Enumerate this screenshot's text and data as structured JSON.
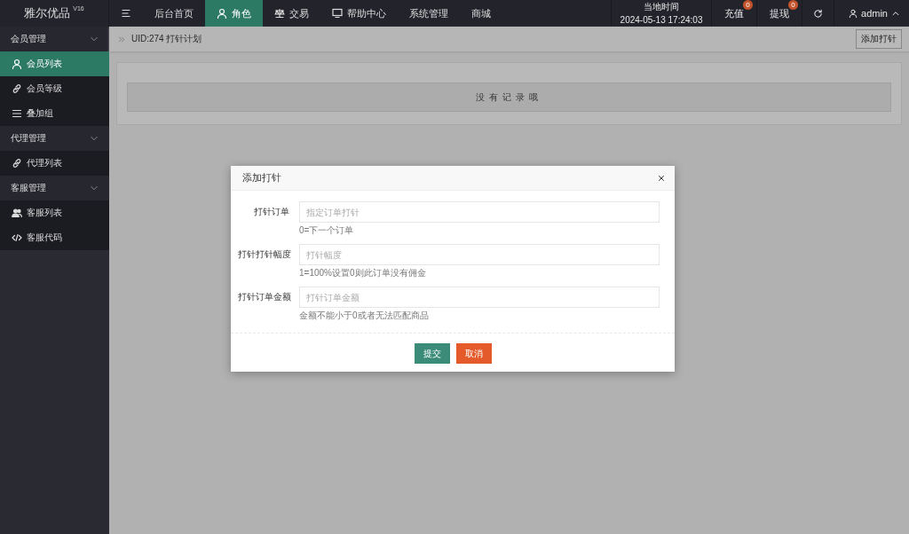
{
  "app": {
    "title": "雅尔优品",
    "version": "V16"
  },
  "top_nav": [
    {
      "kind": "menu-toggle",
      "selected": false
    },
    {
      "kind": "plain",
      "label": "后台首页",
      "selected": false
    },
    {
      "kind": "person",
      "label": "角色",
      "selected": true
    },
    {
      "kind": "scales",
      "label": "交易",
      "selected": false
    },
    {
      "kind": "help",
      "label": "帮助中心",
      "selected": false
    },
    {
      "kind": "plain",
      "label": "系统管理",
      "selected": false
    },
    {
      "kind": "plain",
      "label": "商城",
      "selected": false
    }
  ],
  "clock": {
    "label": "当地时间",
    "value": "2024-05-13 17:24:03"
  },
  "counters": [
    {
      "label": "充值",
      "badge": "0"
    },
    {
      "label": "提现",
      "badge": "0"
    }
  ],
  "user": {
    "name": "admin"
  },
  "sidebar": {
    "groups": [
      {
        "label": "会员管理",
        "expanded": true,
        "children": [
          {
            "kind": "person",
            "label": "会员列表",
            "selected": true
          },
          {
            "kind": "link",
            "label": "会员等级",
            "selected": false
          },
          {
            "kind": "list",
            "label": "叠加组",
            "selected": false
          }
        ]
      },
      {
        "label": "代理管理",
        "expanded": true,
        "children": [
          {
            "kind": "link",
            "label": "代理列表",
            "selected": false
          }
        ]
      },
      {
        "label": "客服管理",
        "expanded": true,
        "children": [
          {
            "kind": "people",
            "label": "客服列表",
            "selected": false
          },
          {
            "kind": "code",
            "label": "客服代码",
            "selected": false
          }
        ]
      }
    ]
  },
  "page": {
    "breadcrumb": "UID:274 打针计划",
    "add_button": "添加打针",
    "empty_text": "没有记录哦"
  },
  "dialog": {
    "title": "添加打针",
    "fields": [
      {
        "label": "打针订单",
        "placeholder": "指定订单打针",
        "hint": "0=下一个订单"
      },
      {
        "label": "打针打针幅度",
        "placeholder": "打针幅度",
        "hint": "1=100%设置0则此订单没有佣金"
      },
      {
        "label": "打针订单金额",
        "placeholder": "打针订单金额",
        "hint": "金额不能小于0或者无法匹配商品"
      }
    ],
    "buttons": [
      {
        "kind": "primary",
        "label": "提交"
      },
      {
        "kind": "danger",
        "label": "取消"
      }
    ]
  }
}
